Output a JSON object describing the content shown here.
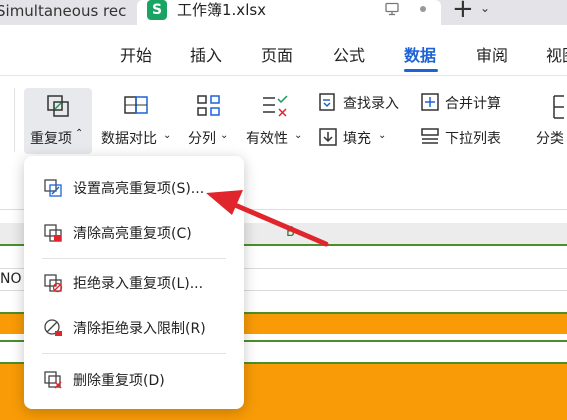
{
  "tabs": {
    "inactive_label": "Simultaneous rec",
    "active_badge": "S",
    "active_label": "工作簿1.xlsx",
    "new_tab": "+",
    "new_tab_menu": "⌄"
  },
  "menu": {
    "items": [
      "开始",
      "插入",
      "页面",
      "公式",
      "数据",
      "审阅",
      "视图"
    ],
    "active": "数据"
  },
  "toolbar": {
    "duplicates": "重复项",
    "compare": "数据对比",
    "split": "分列",
    "validity": "有效性",
    "find_entry": "查找录入",
    "fill": "填充",
    "consolidate": "合并计算",
    "dropdown_list": "下拉列表",
    "classify": "分类"
  },
  "sheet": {
    "column_b": "B",
    "cell_partial": "NO"
  },
  "dropdown_menu": {
    "items": [
      {
        "label": "设置高亮重复项(S)..."
      },
      {
        "label": "清除高亮重复项(C)"
      },
      {
        "label": "拒绝录入重复项(L)..."
      },
      {
        "label": "清除拒绝录入限制(R)"
      },
      {
        "label": "删除重复项(D)"
      }
    ]
  },
  "colors": {
    "accent": "#1e63d6",
    "annotation_arrow": "#e0262c",
    "highlight_fill": "#f89b06",
    "grid_green": "#4a8f2a"
  }
}
